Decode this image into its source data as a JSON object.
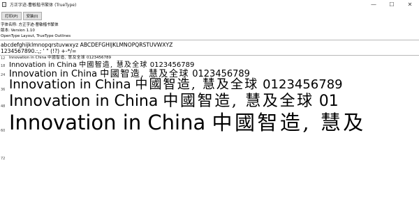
{
  "window": {
    "title": "方正字迹-曹敏楷书繁体 (TrueType)"
  },
  "controls": {
    "minimize": "—",
    "maximize": "☐",
    "close": "✕"
  },
  "toolbar": {
    "print_label": "打印(P)",
    "install_label": "安装(I)"
  },
  "info": {
    "font_name": "字体名称: 方正字迹-曹敏楷书繁体",
    "version": "版本: Version 1.10",
    "outline": "OpenType Layout, TrueType Outlines"
  },
  "charset": {
    "line1": "abcdefghijklmnopqrstuvwxyz ABCDEFGHIJKLMNOPQRSTUVWXYZ",
    "line2": "1234567890.:,; ' \" (!?) +-*/="
  },
  "samples": [
    {
      "size": "12",
      "latin": "Innovation in China",
      "cjk": "中國智造, 慧及全球",
      "digits": "0123456789"
    },
    {
      "size": "18",
      "latin": "Innovation in China",
      "cjk": "中國智造, 慧及全球",
      "digits": "0123456789"
    },
    {
      "size": "24",
      "latin": "Innovation in China",
      "cjk": "中國智造, 慧及全球",
      "digits": "0123456789"
    },
    {
      "size": "36",
      "latin": "Innovation in China",
      "cjk": "中國智造, 慧及全球",
      "digits": "0123456789"
    },
    {
      "size": "48",
      "latin": "Innovation in China",
      "cjk": "中國智造, 慧及全球",
      "digits": "01"
    },
    {
      "size": "60",
      "latin": "Innovation in China",
      "cjk": "中國智造, 慧及",
      "digits": ""
    },
    {
      "size": "72",
      "latin": "",
      "cjk": "",
      "digits": ""
    }
  ]
}
